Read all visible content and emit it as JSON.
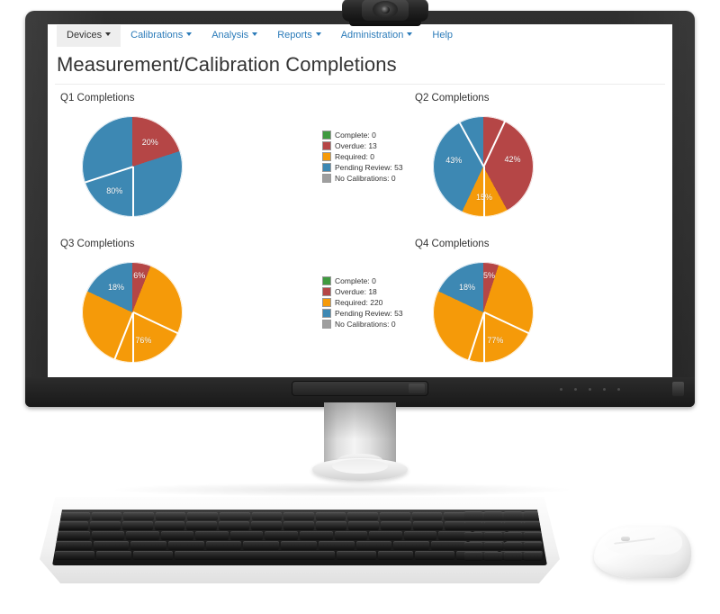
{
  "app": {
    "menu": [
      {
        "label": "Devices",
        "has_caret": true,
        "active": true
      },
      {
        "label": "Calibrations",
        "has_caret": true,
        "active": false
      },
      {
        "label": "Analysis",
        "has_caret": true,
        "active": false
      },
      {
        "label": "Reports",
        "has_caret": true,
        "active": false
      },
      {
        "label": "Administration",
        "has_caret": true,
        "active": false
      },
      {
        "label": "Help",
        "has_caret": false,
        "active": false
      }
    ],
    "page_title": "Measurement/Calibration Completions"
  },
  "colors": {
    "complete": "#3f9a3f",
    "overdue": "#b54646",
    "required": "#f59a09",
    "pending_review": "#3d88b3",
    "no_calibrations": "#9e9e9e",
    "menu_link": "#2b7bb9",
    "bezel": "#262626"
  },
  "legends": [
    {
      "id": "legend-top",
      "rows": [
        {
          "label": "Complete: 0",
          "color": "#3f9a3f"
        },
        {
          "label": "Overdue: 13",
          "color": "#b54646"
        },
        {
          "label": "Required: 0",
          "color": "#f59a09"
        },
        {
          "label": "Pending Review: 53",
          "color": "#3d88b3"
        },
        {
          "label": "No Calibrations: 0",
          "color": "#9e9e9e"
        }
      ]
    },
    {
      "id": "legend-bottom",
      "rows": [
        {
          "label": "Complete: 0",
          "color": "#3f9a3f"
        },
        {
          "label": "Overdue: 18",
          "color": "#b54646"
        },
        {
          "label": "Required: 220",
          "color": "#f59a09"
        },
        {
          "label": "Pending Review: 53",
          "color": "#3d88b3"
        },
        {
          "label": "No Calibrations: 0",
          "color": "#9e9e9e"
        }
      ]
    }
  ],
  "chart_data": [
    {
      "type": "pie",
      "title": "Q1 Completions",
      "labels": [
        "Overdue",
        "Pending Review"
      ],
      "values": [
        20,
        80
      ],
      "data_labels": [
        "20%",
        "80%"
      ],
      "colors": [
        "#b54646",
        "#3d88b3"
      ],
      "legend_position": "center",
      "units": "percent",
      "start_angle": 0
    },
    {
      "type": "pie",
      "title": "Q2 Completions",
      "labels": [
        "Overdue",
        "Required",
        "Pending Review"
      ],
      "values": [
        42,
        15,
        43
      ],
      "data_labels": [
        "42%",
        "15%",
        "43%"
      ],
      "colors": [
        "#b54646",
        "#f59a09",
        "#3d88b3"
      ],
      "legend_position": "center",
      "units": "percent",
      "start_angle": 0
    },
    {
      "type": "pie",
      "title": "Q3 Completions",
      "labels": [
        "Overdue",
        "Required",
        "Pending Review"
      ],
      "values": [
        6,
        76,
        18
      ],
      "data_labels": [
        "6%",
        "76%",
        "18%"
      ],
      "colors": [
        "#b54646",
        "#f59a09",
        "#3d88b3"
      ],
      "legend_position": "center",
      "units": "percent",
      "start_angle": 0
    },
    {
      "type": "pie",
      "title": "Q4 Completions",
      "labels": [
        "Overdue",
        "Required",
        "Pending Review"
      ],
      "values": [
        5,
        77,
        18
      ],
      "data_labels": [
        "5%",
        "77%",
        "18%"
      ],
      "colors": [
        "#b54646",
        "#f59a09",
        "#3d88b3"
      ],
      "legend_position": "center",
      "units": "percent",
      "start_angle": 0
    }
  ],
  "hardware": {
    "webcam_label": "webcam",
    "monitor_label": "desktop-monitor",
    "keyboard_label": "keyboard",
    "mouse_label": "mouse"
  }
}
